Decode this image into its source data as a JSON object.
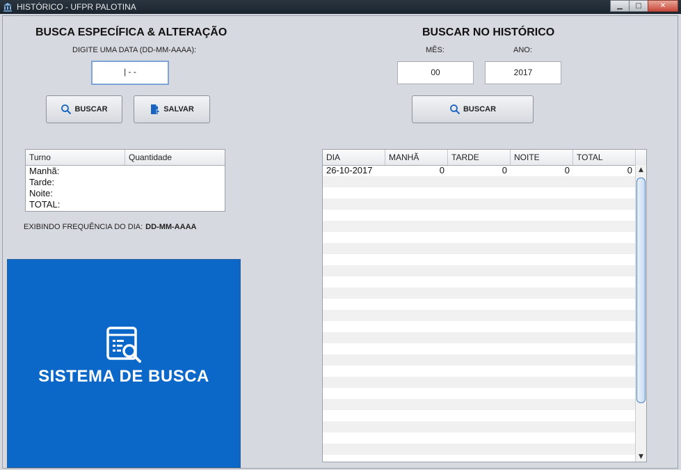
{
  "window": {
    "title": "HISTÓRICO - UFPR PALOTINA",
    "minimize": "▁",
    "maximize": "□",
    "close": "✕"
  },
  "left": {
    "heading": "BUSCA ESPECÍFICA & ALTERAÇÃO",
    "date_label": "DIGITE UMA DATA (DD-MM-AAAA):",
    "date_value": "| - -",
    "search_button": "BUSCAR",
    "save_button": "SALVAR",
    "table": {
      "columns": [
        "Turno",
        "Quantidade"
      ],
      "rows": [
        "Manhã:",
        "Tarde:",
        "Noite:",
        "TOTAL:"
      ]
    },
    "freq_label": "EXIBINDO FREQUÊNCIA DO DIA:",
    "freq_value": "DD-MM-AAAA",
    "banner_text": "SISTEMA DE BUSCA"
  },
  "right": {
    "heading": "BUSCAR NO HISTÓRICO",
    "month_label": "MÊS:",
    "year_label": "ANO:",
    "month_value": "00",
    "year_value": "2017",
    "search_button": "BUSCAR",
    "table": {
      "columns": [
        "DIA",
        "MANHÃ",
        "TARDE",
        "NOITE",
        "TOTAL"
      ],
      "rows": [
        [
          "26-10-2017",
          "0",
          "0",
          "0",
          "0"
        ]
      ]
    }
  },
  "icons": {
    "app": "bank-icon",
    "search": "magnifier-icon",
    "save": "save-document-icon",
    "banner": "search-document-icon"
  },
  "colors": {
    "banner": "#0b68c8",
    "accent": "#4a7fc2"
  }
}
